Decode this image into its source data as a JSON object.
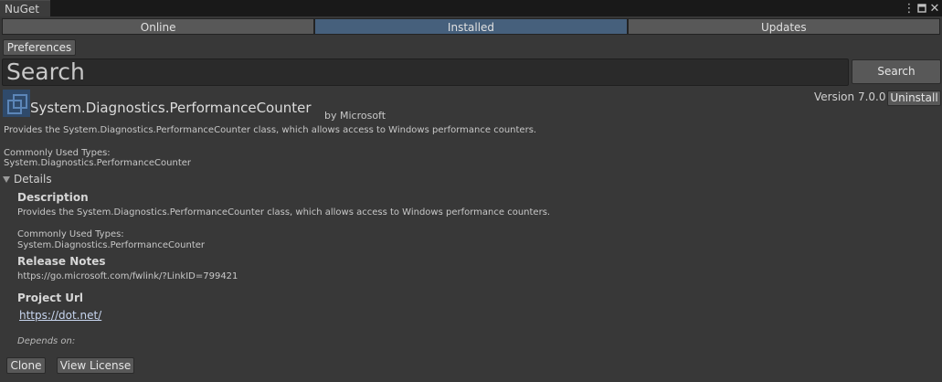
{
  "window": {
    "tab_title": "NuGet"
  },
  "tabs": [
    "Online",
    "Installed",
    "Updates"
  ],
  "toolbar": {
    "preferences_label": "Preferences"
  },
  "search": {
    "text": "Search",
    "button_label": "Search"
  },
  "package": {
    "name": "System.Diagnostics.PerformanceCounter",
    "by": "by Microsoft",
    "version": "Version 7.0.0",
    "uninstall_label": "Uninstall",
    "summary": "Provides the System.Diagnostics.PerformanceCounter class, which allows access to Windows performance counters.",
    "types_label": "Commonly Used Types:",
    "types_value": "System.Diagnostics.PerformanceCounter"
  },
  "details": {
    "toggle_label": "Details",
    "description_heading": "Description",
    "description": "Provides the System.Diagnostics.PerformanceCounter class, which allows access to Windows performance counters.",
    "types_label": "Commonly Used Types:",
    "types_value": "System.Diagnostics.PerformanceCounter",
    "release_notes_heading": "Release Notes",
    "release_notes_url": "https://go.microsoft.com/fwlink/?LinkID=799421",
    "project_url_heading": "Project Url",
    "project_url": "https://dot.net/",
    "depends_on": "Depends on:"
  },
  "footer": {
    "clone_label": "Clone",
    "view_license_label": "View License"
  }
}
